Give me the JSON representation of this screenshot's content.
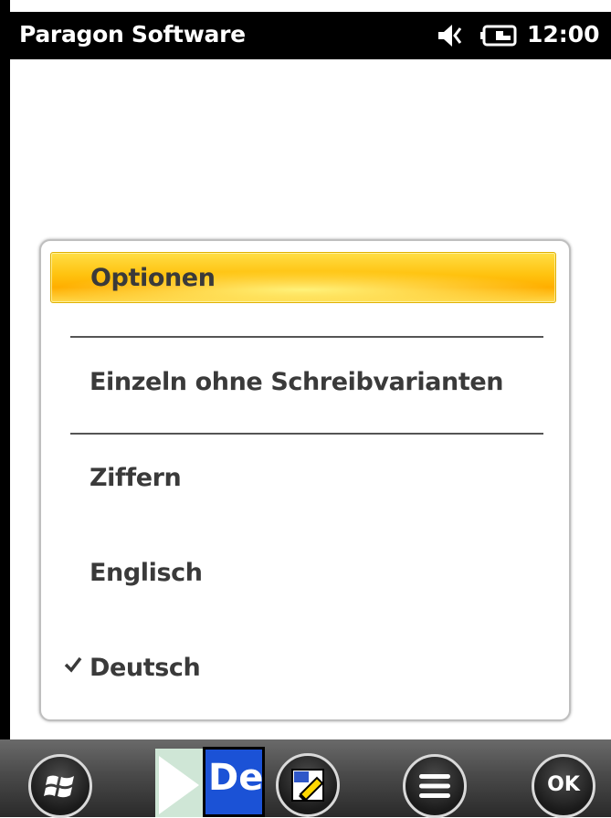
{
  "status_bar": {
    "app_title": "Paragon Software",
    "clock": "12:00",
    "icons": [
      "speaker-muted-icon",
      "battery-charging-icon"
    ]
  },
  "menu": {
    "items": [
      {
        "label": "Optionen",
        "selected": true,
        "checked": false
      },
      {
        "label": "Einzeln ohne Schreibvarianten",
        "selected": false,
        "checked": false
      },
      {
        "label": "Ziffern",
        "selected": false,
        "checked": false
      },
      {
        "label": "Englisch",
        "selected": false,
        "checked": false
      },
      {
        "label": "Deutsch",
        "selected": false,
        "checked": true
      }
    ],
    "highlight_color": "#ffc20e",
    "check_icon": "checkmark-icon"
  },
  "taskbar": {
    "start_icon": "windows-start-icon",
    "input_language": "De",
    "input_icons": [
      "play-icon",
      "keyboard-language-icon",
      "handwriting-input-icon"
    ],
    "menu_icon": "hamburger-menu-icon",
    "ok_label": "OK"
  }
}
